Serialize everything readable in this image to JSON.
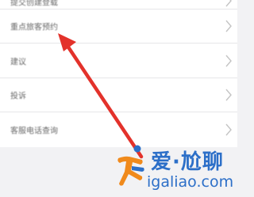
{
  "menu": {
    "items": [
      {
        "label": "提交创建登载"
      },
      {
        "label": "重点旅客预约"
      },
      {
        "label": "建议"
      },
      {
        "label": "投诉"
      },
      {
        "label": "客服电话查询"
      }
    ]
  },
  "watermark": {
    "brand": "爱·尬聊",
    "url": "igaliao.com"
  },
  "colors": {
    "arrow": "#e3322b",
    "brand_blue": "#2c6fc8",
    "brand_orange": "#f08a1c"
  },
  "icons": {
    "chevron": "chevron-right-icon",
    "annotation": "red-arrow-icon",
    "logo": "running-figure-logo-icon"
  }
}
